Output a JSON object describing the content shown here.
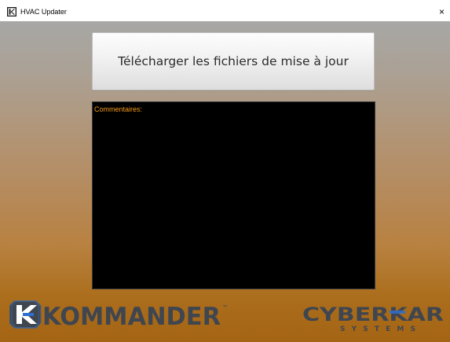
{
  "window": {
    "title": "HVAC Updater",
    "close_glyph": "×",
    "app_icon": "kommander-k-icon"
  },
  "main": {
    "download_button_label": "Télécharger les fichiers de mise à jour",
    "comments_label": "Commentaires:"
  },
  "branding": {
    "left_logo_text": "KOMMANDER",
    "left_logo_trademark": "™",
    "right_logo_text": "CYBERKAR",
    "right_logo_subtext": "SYSTEMS"
  },
  "colors": {
    "comments_label": "#f59a16",
    "accent_blue": "#2e6fcf",
    "logo_dark": "#3f4650"
  }
}
